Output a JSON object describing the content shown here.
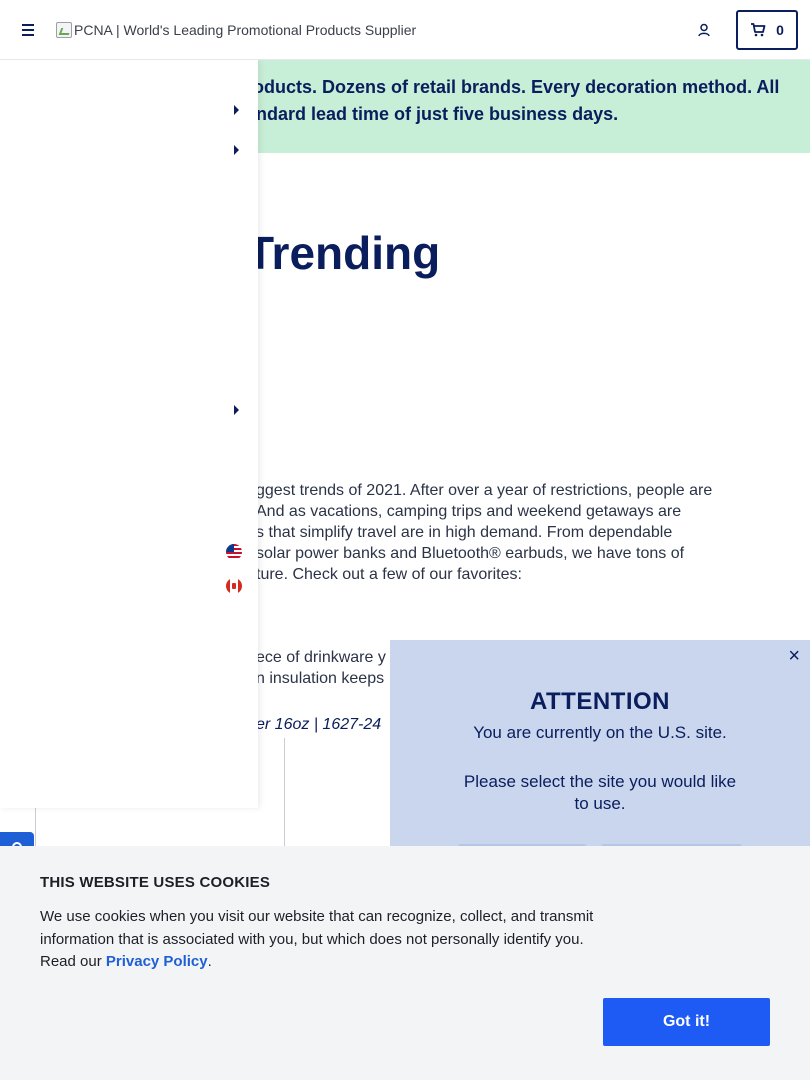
{
  "header": {
    "logo_alt": "PCNA | World's Leading Promotional Products Supplier",
    "cart_count": "0"
  },
  "banner": {
    "text": "roducts. Dozens of retail brands. Every decoration method. All\nandard lead time of just five business days."
  },
  "main": {
    "title_fragment": "Trending",
    "paragraph": "ggest trends of 2021. After over a year of restrictions, people are\nAnd as vacations, camping trips and weekend getaways are\ns that simplify travel are in high demand. From dependable\nsolar power banks and Bluetooth® earbuds, we have tons of\nture. Check out a few of our favorites:",
    "paragraph2": "ece of drinkware y\nn insulation keeps",
    "product_link": "er 16oz | 1627-24"
  },
  "attention": {
    "close_symbol": "×",
    "title": "ATTENTION",
    "message": "You are currently on the U.S. site.",
    "question": "Please select the site you would like to use."
  },
  "cookie": {
    "title": "THIS WEBSITE USES COOKIES",
    "text_before_link": "We use cookies when you visit our website that can recognize, collect, and transmit information that is associated with you, but which does not personally identify you. Read our ",
    "link_label": "Privacy Policy",
    "text_after_link": ".",
    "button_label": "Got it!"
  },
  "icons": {
    "menu": "hamburger-icon",
    "account": "user-icon",
    "cart": "cart-icon",
    "chat": "chat-icon",
    "flags": [
      "us-flag-icon",
      "canada-flag-icon"
    ]
  },
  "colors": {
    "brand_navy": "#0a1d5c",
    "banner_green": "#c7eed6",
    "attention_blue": "#c9d6ee",
    "cookie_button": "#1e5bf5",
    "cookie_bg": "#f3f4f6"
  }
}
